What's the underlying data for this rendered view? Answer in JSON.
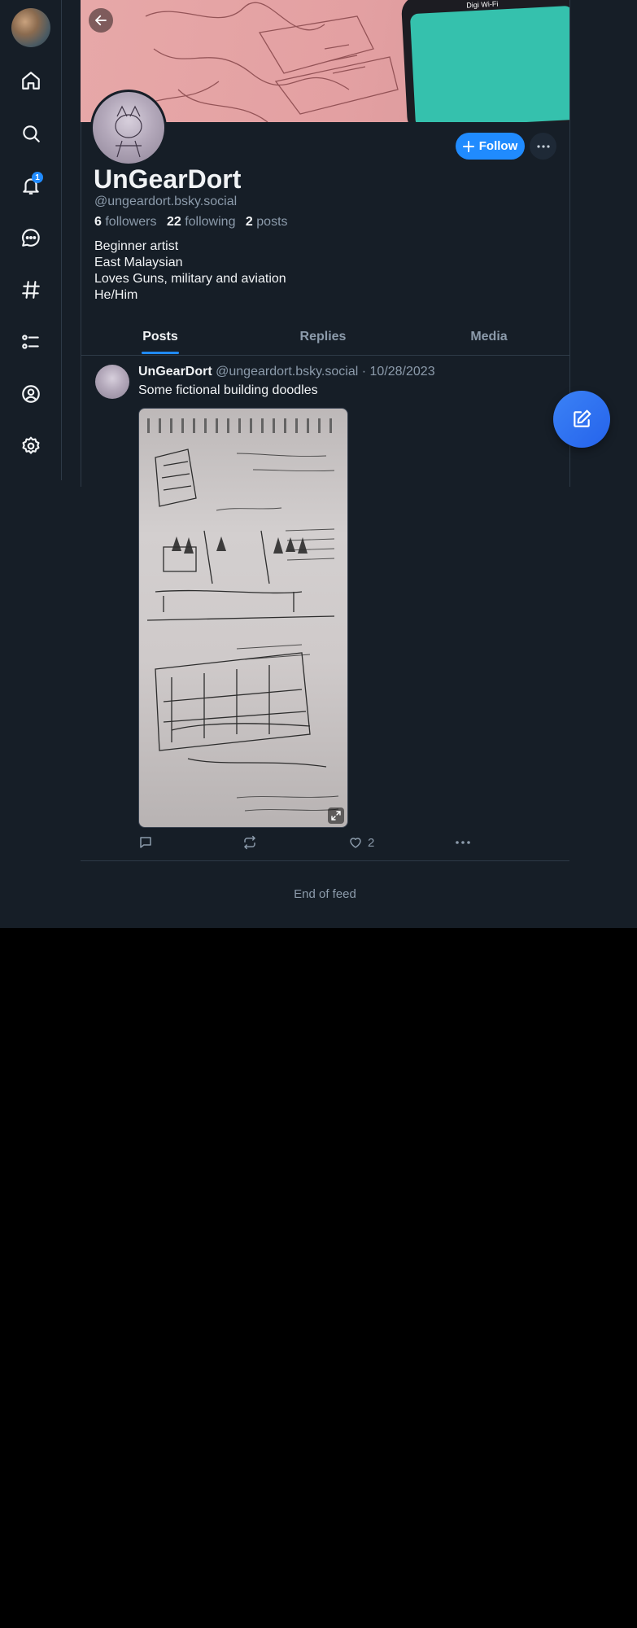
{
  "rail": {
    "notifications_badge": "1",
    "items": [
      {
        "icon": "home-icon"
      },
      {
        "icon": "search-icon"
      },
      {
        "icon": "bell-icon"
      },
      {
        "icon": "chat-icon"
      },
      {
        "icon": "hashtag-icon"
      },
      {
        "icon": "list-icon"
      },
      {
        "icon": "profile-icon"
      },
      {
        "icon": "gear-icon"
      }
    ]
  },
  "banner": {
    "phone_status": "Digi Wi-Fi"
  },
  "profile": {
    "display_name": "UnGearDort",
    "handle": "@ungeardort.bsky.social",
    "followers_count": "6",
    "followers_label": "followers",
    "following_count": "22",
    "following_label": "following",
    "posts_count": "2",
    "posts_label": "posts",
    "bio": [
      "Beginner artist",
      "East Malaysian",
      "Loves Guns, military and aviation",
      "He/Him"
    ],
    "follow_label": "Follow"
  },
  "tabs": [
    "Posts",
    "Replies",
    "Media"
  ],
  "post": {
    "author": "UnGearDort",
    "handle": "@ungeardort.bsky.social",
    "separator": "·",
    "date": "10/28/2023",
    "text": "Some fictional building doodles",
    "like_count": "2"
  },
  "feed": {
    "end_label": "End of feed"
  },
  "colors": {
    "background": "#161e27",
    "accent": "#208bfe",
    "muted": "#8c9bab",
    "border": "#2e3a47"
  }
}
